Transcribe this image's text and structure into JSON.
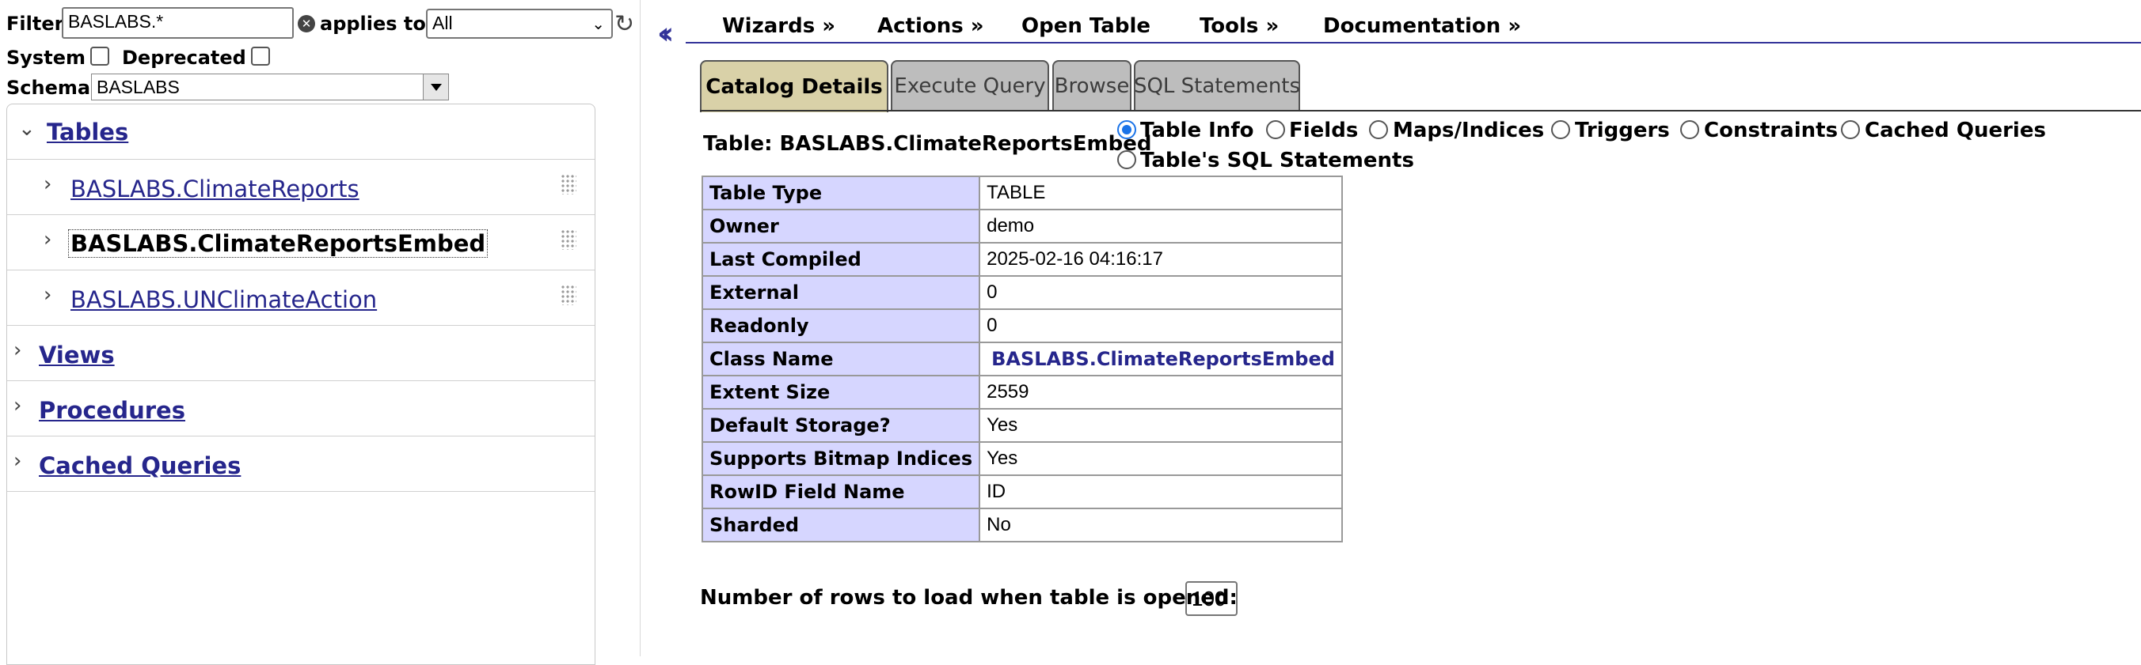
{
  "filter": {
    "label": "Filter",
    "value": "BASLABS.*",
    "applies_to_label": "applies to",
    "applies_to_value": "All"
  },
  "options": {
    "system_label": "System",
    "deprecated_label": "Deprecated"
  },
  "schema": {
    "label": "Schema",
    "value": "BASLABS"
  },
  "tree": {
    "tables_label": "Tables",
    "tables": [
      {
        "label": "BASLABS.ClimateReports"
      },
      {
        "label": "BASLABS.ClimateReportsEmbed"
      },
      {
        "label": "BASLABS.UNClimateAction"
      }
    ],
    "views_label": "Views",
    "procedures_label": "Procedures",
    "cached_queries_label": "Cached Queries"
  },
  "menu": {
    "items": [
      "Wizards »",
      "Actions »",
      "Open Table",
      "Tools »",
      "Documentation »"
    ]
  },
  "tabs": [
    "Catalog Details",
    "Execute Query",
    "Browse",
    "SQL Statements"
  ],
  "details": {
    "caption": "Table: BASLABS.ClimateReportsEmbed",
    "radios": [
      "Table Info",
      "Fields",
      "Maps/Indices",
      "Triggers",
      "Constraints",
      "Cached Queries",
      "Table's SQL Statements"
    ],
    "rows": [
      {
        "key": "Table Type",
        "value": "TABLE"
      },
      {
        "key": "Owner",
        "value": "demo"
      },
      {
        "key": "Last Compiled",
        "value": "2025-02-16 04:16:17"
      },
      {
        "key": "External",
        "value": "0"
      },
      {
        "key": "Readonly",
        "value": "0"
      },
      {
        "key": "Class Name",
        "value": "BASLABS.ClimateReportsEmbed"
      },
      {
        "key": "Extent Size",
        "value": "2559"
      },
      {
        "key": "Default Storage?",
        "value": "Yes"
      },
      {
        "key": "Supports Bitmap Indices",
        "value": "Yes"
      },
      {
        "key": "RowID Field Name",
        "value": "ID"
      },
      {
        "key": "Sharded",
        "value": "No"
      }
    ],
    "rows_to_load_label": "Number of rows to load when table is opened:",
    "rows_to_load_value": "100"
  },
  "colors": {
    "link": "#26268c",
    "key_cell_bg": "#d6d6ff",
    "active_tab_bg": "#d9d1a8",
    "inactive_tab_bg": "#bdbdbd",
    "menu_rule": "#333399"
  }
}
